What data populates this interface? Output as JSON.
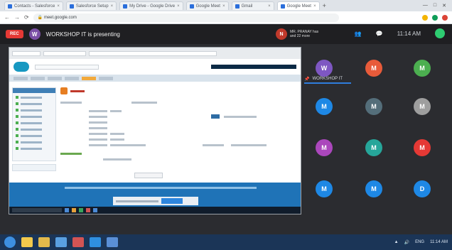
{
  "browser": {
    "tabs": [
      {
        "label": "Contacts - Salesforce"
      },
      {
        "label": "Salesforce Setup"
      },
      {
        "label": "My Drive - Google Drive"
      },
      {
        "label": "Google Meet"
      },
      {
        "label": "Gmail"
      },
      {
        "label": "Google Meet"
      }
    ],
    "url": "meet.google.com"
  },
  "meeting": {
    "rec_label": "REC",
    "presenter_initial": "W",
    "presenting_text": "WORKSHOP IT is presenting",
    "notification": {
      "initial": "N",
      "line1": "MR. PRANAY has",
      "line2": "and 22 more"
    },
    "time": "11:14 AM",
    "participants_label": "WORKSHOP IT",
    "participants": [
      {
        "initial": "W",
        "color": "#7e57c2"
      },
      {
        "initial": "M",
        "color": "#e85b3a"
      },
      {
        "initial": "M",
        "color": "#4caf50"
      },
      {
        "initial": "M",
        "color": "#1e88e5"
      },
      {
        "initial": "M",
        "color": "#546e7a"
      },
      {
        "initial": "M",
        "color": "#9e9e9e"
      },
      {
        "initial": "M",
        "color": "#ab47bc"
      },
      {
        "initial": "M",
        "color": "#26a69a"
      },
      {
        "initial": "M",
        "color": "#e53935"
      },
      {
        "initial": "M",
        "color": "#1e88e5"
      },
      {
        "initial": "M",
        "color": "#1e88e5"
      },
      {
        "initial": "D",
        "color": "#1e88e5"
      }
    ]
  },
  "taskbar": {
    "icons": [
      {
        "name": "chrome-icon",
        "color": "#f2c94c"
      },
      {
        "name": "folder-icon",
        "color": "#e2b94b"
      },
      {
        "name": "media-icon",
        "color": "#5aa0e0"
      },
      {
        "name": "app-icon",
        "color": "#d35454"
      },
      {
        "name": "skype-icon",
        "color": "#2f8fe0"
      },
      {
        "name": "app2-icon",
        "color": "#5a8fd6"
      }
    ],
    "language": "ENG",
    "time": "11:14 AM"
  }
}
